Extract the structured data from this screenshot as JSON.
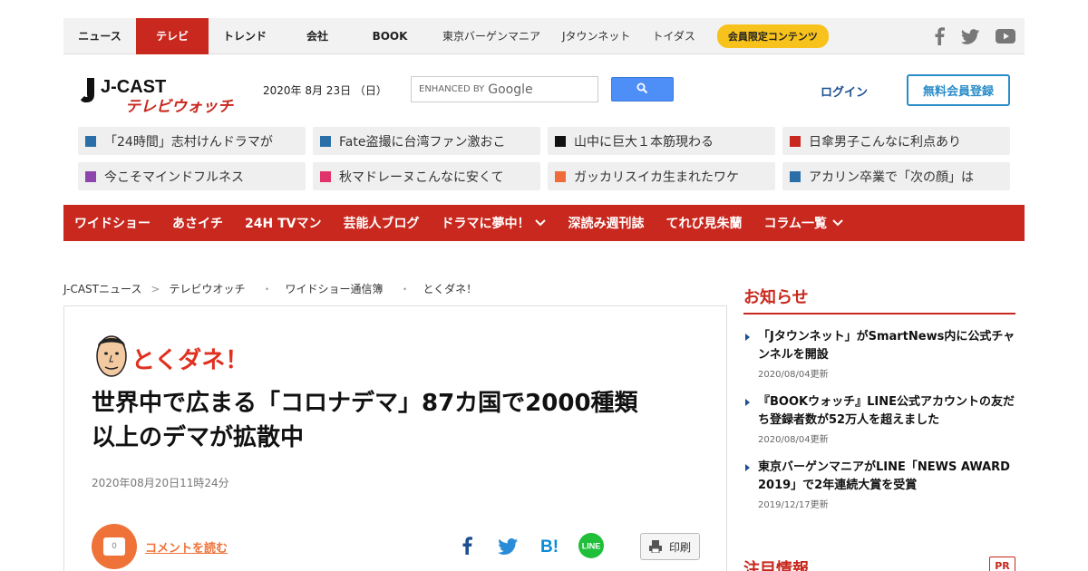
{
  "topnav": {
    "tabs": [
      "ニュース",
      "テレビ",
      "トレンド",
      "会社",
      "BOOK"
    ],
    "active_tab": "テレビ",
    "external_links": [
      "東京バーゲンマニア",
      "Jタウンネット",
      "トイダス"
    ],
    "member_label": "会員限定コンテンツ",
    "social_icons": [
      "facebook-icon",
      "twitter-icon",
      "youtube-icon"
    ]
  },
  "header": {
    "logo_top": "J-CAST",
    "logo_sub": "テレビウォッチ",
    "date": "2020年 8月 23日 （日）",
    "search_enhanced": "ENHANCED BY",
    "search_brand": "Google",
    "login": "ログイン",
    "register": "無料会員登録"
  },
  "trending": [
    {
      "label": "「24時間」志村けんドラマが",
      "color": "#2a6fa8"
    },
    {
      "label": "Fate盗撮に台湾ファン激おこ",
      "color": "#2a6fa8"
    },
    {
      "label": "山中に巨大１本筋現わる",
      "color": "#111111"
    },
    {
      "label": "日傘男子こんなに利点あり",
      "color": "#c8281e"
    },
    {
      "label": "今こそマインドフルネス",
      "color": "#8e44ad"
    },
    {
      "label": "秋マドレーヌこんなに安くて",
      "color": "#e0336b"
    },
    {
      "label": "ガッカリスイカ生まれたワケ",
      "color": "#ef6c3a"
    },
    {
      "label": "アカリン卒業で「次の顔」は",
      "color": "#2a6fa8"
    }
  ],
  "categories": [
    {
      "label": "ワイドショー",
      "dropdown": false
    },
    {
      "label": "あさイチ",
      "dropdown": false
    },
    {
      "label": "24H TVマン",
      "dropdown": false
    },
    {
      "label": "芸能人ブログ",
      "dropdown": false
    },
    {
      "label": "ドラマに夢中！",
      "dropdown": true
    },
    {
      "label": "深読み週刊誌",
      "dropdown": false
    },
    {
      "label": "てれび見朱蘭",
      "dropdown": false
    },
    {
      "label": "コラム一覧",
      "dropdown": true
    }
  ],
  "breadcrumb": [
    "J-CASTニュース",
    "テレビウオッチ",
    "ワイドショー通信簿",
    "とくダネ！"
  ],
  "article": {
    "program": "とくダネ！",
    "title_line1": "世界中で広まる「コロナデマ」87カ国で2000種類",
    "title_line2": "以上のデマが拡散中",
    "published": "2020年08月20日11時24分",
    "comment_count": "0",
    "comment_link": "コメントを読む",
    "share_icons": [
      "facebook-icon",
      "twitter-icon",
      "hatena-bookmark-icon",
      "line-icon"
    ],
    "share_line": "LINE",
    "share_hatena": "B!",
    "print": "印刷"
  },
  "sidebar": {
    "heading": "お知らせ",
    "notices": [
      {
        "text": "「Jタウンネット」がSmartNews内に公式チャンネルを開設",
        "date": "2020/08/04更新"
      },
      {
        "text": "『BOOKウォッチ』LINE公式アカウントの友だち登録者数が52万人を超えました",
        "date": "2020/08/04更新"
      },
      {
        "text": "東京バーゲンマニアがLINE「NEWS AWARD 2019」で2年連続大賞を受賞",
        "date": "2019/12/17更新"
      }
    ],
    "heading2": "注目情報",
    "pr": "PR"
  },
  "colors": {
    "brand_red": "#c8281e",
    "accent_orange": "#ef7239",
    "link_blue": "#1d4f91",
    "member_yellow": "#f7c21b",
    "google_blue": "#4d8ef7"
  }
}
